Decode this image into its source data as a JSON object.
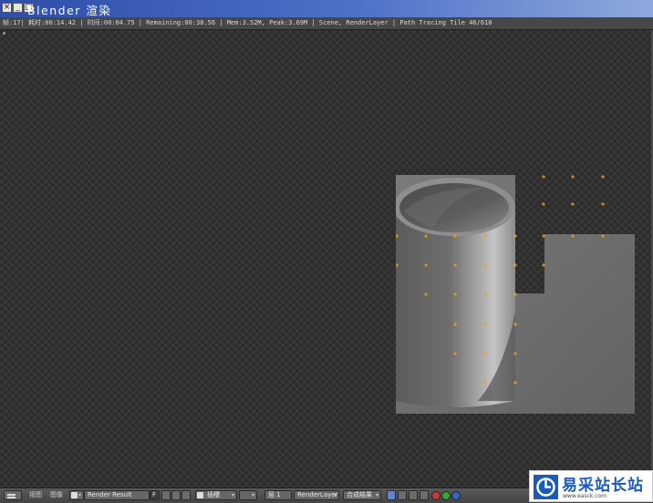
{
  "window": {
    "title": "Blender 渲染",
    "controls": [
      "close",
      "minimize",
      "maximize"
    ]
  },
  "info_bar": {
    "text": "帧:17| 耗时:00:14.42 | 时间:00:04.75 | Remaining:00:38.56 | Mem:3.52M, Peak:3.69M | Scene, RenderLayer | Path Tracing Tile 46/610"
  },
  "header": {
    "view_menu": "视图",
    "image_menu": "图像",
    "image_name": "Render Result",
    "image_user_count": "F",
    "slot": "插槽",
    "layer": "层 1",
    "render_layer": "RenderLayer",
    "pass": "合成结果"
  },
  "colors": {
    "title_bar": "#3a5fbc",
    "viewport_bg": "#2c2c2c",
    "header_bg": "#4e4e4e",
    "tile_marker": "#e9a21f"
  },
  "icons": [
    "window-close-icon",
    "window-minimize-icon",
    "window-maximize-icon",
    "editor-type-icon",
    "image-browse-icon",
    "new-image-icon",
    "open-image-icon",
    "unlink-image-icon",
    "slot-icon",
    "display-channels-icon",
    "draw-rgb-icon",
    "draw-alpha-icon",
    "draw-z-icon",
    "render-red-icon",
    "render-green-icon",
    "render-blue-icon"
  ],
  "watermark": {
    "text": "易采站长站",
    "url": "www.easck.com"
  }
}
